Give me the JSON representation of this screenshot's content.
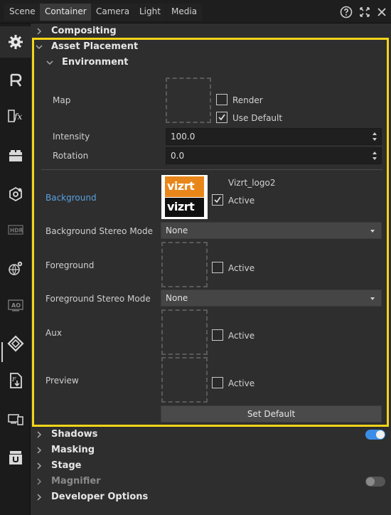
{
  "tabs": [
    "Scene",
    "Container",
    "Camera",
    "Light",
    "Media"
  ],
  "active_tab": "Container",
  "header_icons": [
    "help-icon",
    "expand-icon",
    "close-icon"
  ],
  "rail": [
    "settings-icon",
    "render-r-icon",
    "fx-icon",
    "toolbar-icon",
    "hexagon-icon",
    "hdr-icon",
    "globe-pin-icon",
    "ao-icon",
    "vizrt-diamond-icon",
    "file-export-icon",
    "devices-icon",
    "plugin-u-icon"
  ],
  "sections": {
    "compositing": "Compositing",
    "asset_placement": "Asset Placement",
    "environment": "Environment",
    "shadows": "Shadows",
    "masking": "Masking",
    "stage": "Stage",
    "magnifier": "Magnifier",
    "developer_options": "Developer Options"
  },
  "environment": {
    "map_label": "Map",
    "render_label": "Render",
    "use_default_label": "Use Default",
    "render_checked": false,
    "use_default_checked": true,
    "intensity_label": "Intensity",
    "intensity_value": "100.0",
    "rotation_label": "Rotation",
    "rotation_value": "0.0"
  },
  "background": {
    "label": "Background",
    "asset_name": "Vizrt_logo2",
    "logo_top_text": "vizrt",
    "logo_bottom_text": "vizrt",
    "active_label": "Active",
    "active_checked": true
  },
  "background_stereo": {
    "label": "Background Stereo Mode",
    "value": "None"
  },
  "foreground": {
    "label": "Foreground",
    "active_label": "Active",
    "active_checked": false
  },
  "foreground_stereo": {
    "label": "Foreground Stereo Mode",
    "value": "None"
  },
  "aux": {
    "label": "Aux",
    "active_label": "Active",
    "active_checked": false
  },
  "preview": {
    "label": "Preview",
    "active_label": "Active",
    "active_checked": false
  },
  "set_default_label": "Set Default",
  "toggles": {
    "shadows_on": true,
    "magnifier_on": false
  },
  "colors": {
    "highlight": "#f4d41a",
    "link": "#5aa1e0",
    "toggle_on": "#3b8ee8"
  }
}
